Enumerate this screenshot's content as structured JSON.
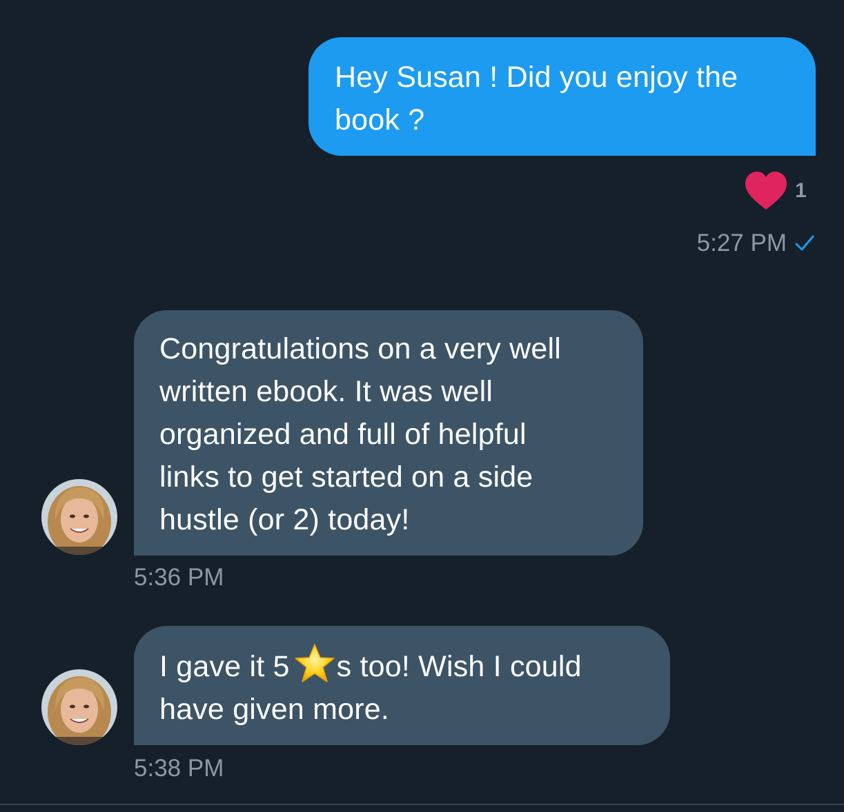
{
  "colors": {
    "background": "#15202b",
    "outgoing_bubble": "#1d9bf0",
    "incoming_bubble": "#3d5466",
    "heart": "#e0245e",
    "timestamp": "#8b98a5"
  },
  "messages": [
    {
      "direction": "outgoing",
      "lines": [
        "Hey Susan ! Did you enjoy the",
        "book ?"
      ],
      "reaction": {
        "icon": "heart-icon",
        "count": "1"
      },
      "time": "5:27 PM",
      "read_icon": "checkmark-icon"
    },
    {
      "direction": "incoming",
      "lines": [
        "Congratulations on a very well",
        "written ebook. It was well",
        "organized and full of helpful",
        "links to get started on a side",
        "hustle (or 2) today!"
      ],
      "time": "5:36 PM",
      "avatar_icon": "user-avatar"
    },
    {
      "direction": "incoming",
      "line1_before": "I gave it 5",
      "emoji": "star-emoji",
      "line1_after": "s too! Wish I could",
      "line2": "have given more.",
      "time": "5:38 PM",
      "avatar_icon": "user-avatar"
    }
  ]
}
